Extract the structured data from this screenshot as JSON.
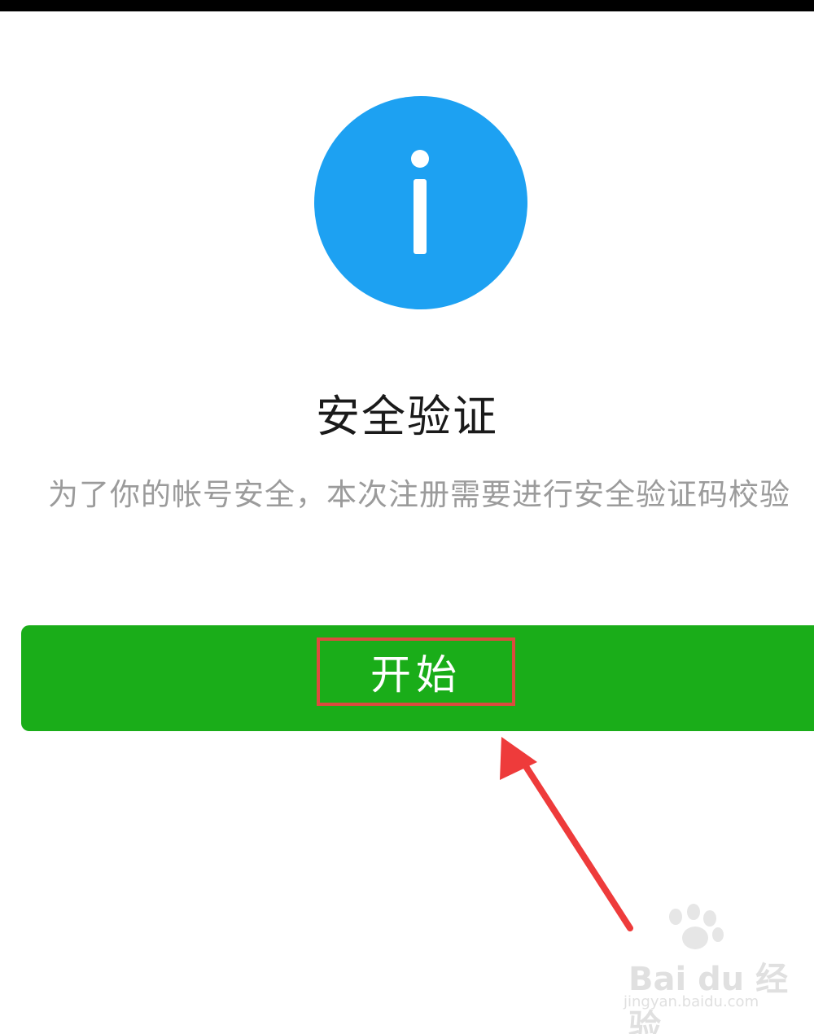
{
  "title": "安全验证",
  "description": "为了你的帐号安全，本次注册需要进行安全验证码校验",
  "start_button": {
    "label": "开始"
  },
  "icons": {
    "info": "info-icon",
    "annotation_arrow": "red-arrow-icon"
  },
  "watermark": {
    "brand": "Bai du 经验",
    "url": "jingyan.baidu.com"
  },
  "colors": {
    "icon_blue": "#1da1f2",
    "button_green": "#1aad19",
    "highlight_red": "#dd4b3e",
    "arrow_red": "#ee3b3b"
  }
}
